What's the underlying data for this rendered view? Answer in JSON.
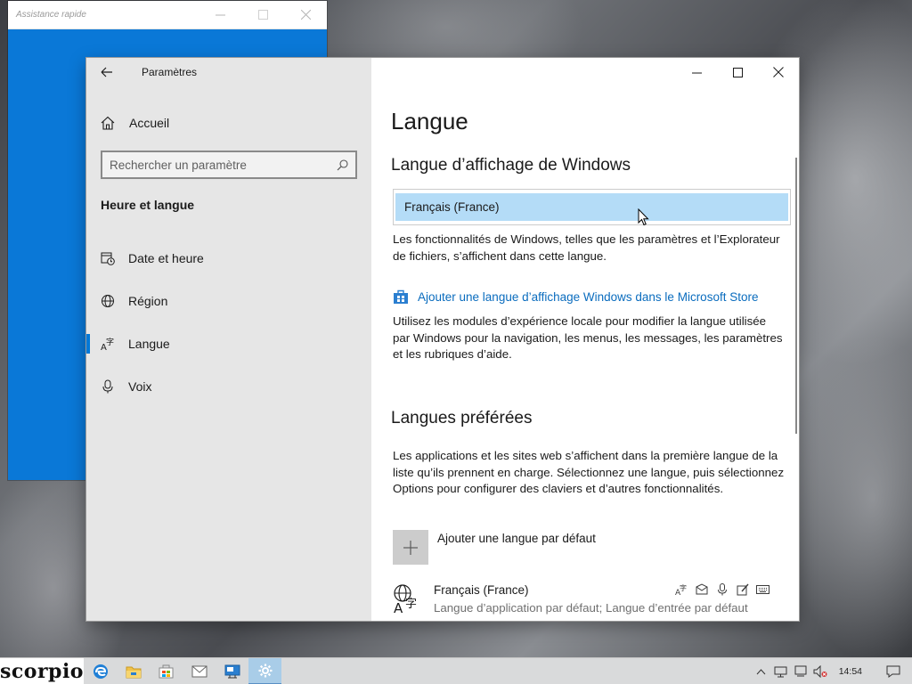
{
  "quick_assist": {
    "title": "Assistance rapide"
  },
  "settings": {
    "app_title": "Paramètres",
    "sidebar": {
      "home_label": "Accueil",
      "search_placeholder": "Rechercher un paramètre",
      "section_title": "Heure et langue",
      "items": [
        {
          "label": "Date et heure",
          "icon": "clock-calendar-icon",
          "active": false
        },
        {
          "label": "Région",
          "icon": "region-globe-icon",
          "active": false
        },
        {
          "label": "Langue",
          "icon": "language-icon",
          "active": true
        },
        {
          "label": "Voix",
          "icon": "microphone-icon",
          "active": false
        }
      ]
    },
    "content": {
      "page_title": "Langue",
      "display_language": {
        "heading": "Langue d’affichage de Windows",
        "selected_value": "Français (France)",
        "description": "Les fonctionnalités de Windows, telles que les paramètres et l’Explorateur de fichiers, s’affichent dans cette langue.",
        "store_link": "Ajouter une langue d’affichage Windows dans le Microsoft Store",
        "store_description": "Utilisez les modules d’expérience locale pour modifier la langue utilisée par Windows pour la navigation, les menus, les messages, les paramètres et les rubriques d’aide."
      },
      "preferred": {
        "heading": "Langues préférées",
        "description": "Les applications et les sites web s’affichent dans la première langue de la liste qu’ils prennent en charge. Sélectionnez une langue, puis sélectionnez Options pour configurer des claviers et d’autres fonctionnalités.",
        "add_label": "Ajouter une langue par défaut",
        "languages": [
          {
            "name": "Français (France)",
            "subtitle": "Langue d’application par défaut; Langue d’entrée par défaut"
          }
        ]
      }
    }
  },
  "taskbar": {
    "start_label": "scorpio",
    "clock": "14:54",
    "accent": "#0078d7"
  }
}
